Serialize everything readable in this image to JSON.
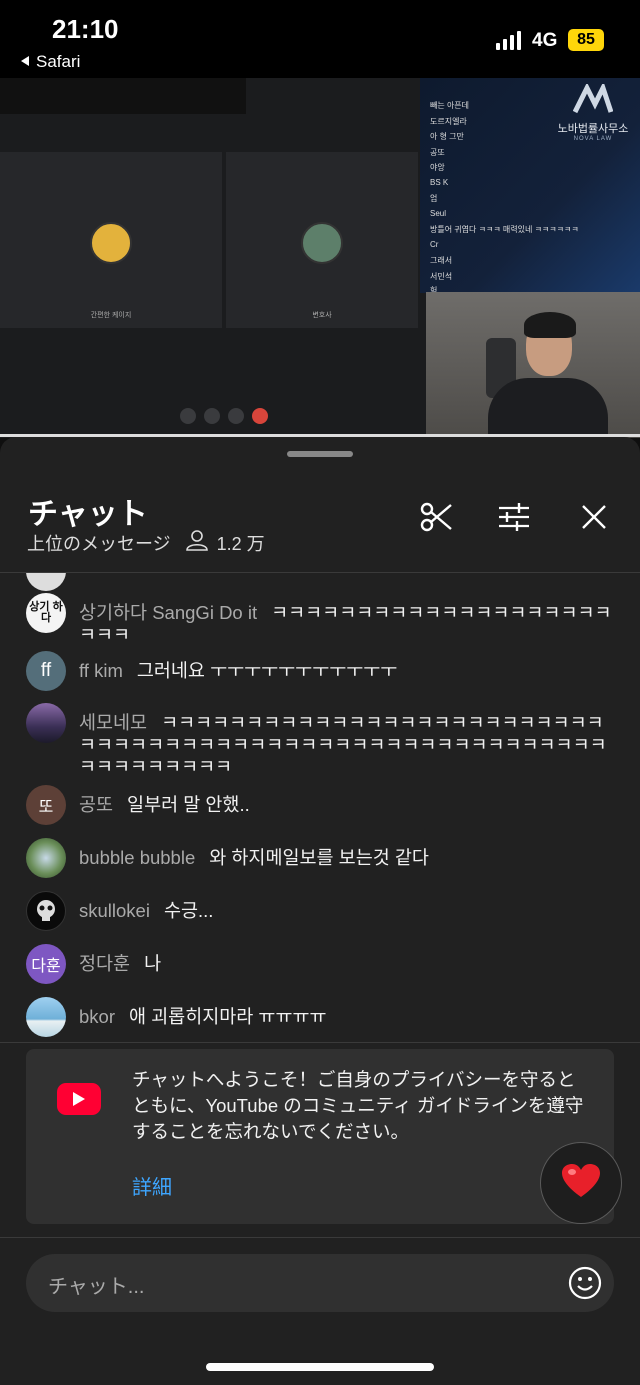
{
  "status_bar": {
    "time": "21:10",
    "back_label": "Safari",
    "network": "4G",
    "battery": "85"
  },
  "video": {
    "participants": [
      "간편한 케이지",
      "변호사"
    ],
    "side_chat_lines": [
      "빼는 아픈데",
      "도르지엘라",
      "아 형 그만",
      "공또",
      "야앙",
      "BS K",
      "엄",
      "Seul",
      "방틀어 귀엽다 ㅋㅋㅋ 매력있네 ㅋㅋㅋㅋㅋㅋ",
      "Cr",
      "그래서",
      "서민석",
      "헉"
    ],
    "logo_korean": "노바법률사무소",
    "logo_english": "NOVA LAW"
  },
  "chat": {
    "title": "チャット",
    "mode": "上位のメッセージ",
    "viewers": "1.2 万",
    "icons": {
      "scissors": "scissors-icon",
      "filter": "filter-icon",
      "close": "close-icon"
    },
    "messages": [
      {
        "author": "상기하다 SangGi Do it",
        "text": "ㅋㅋㅋㅋㅋㅋㅋㅋㅋㅋㅋㅋㅋㅋㅋㅋㅋㅋㅋㅋㅋㅋㅋ",
        "avatar_text": "상기 하다",
        "avatar_color": "#f4f4f4"
      },
      {
        "author": "ff kim",
        "text": "그러네요 ㅜㅜㅜㅜㅜㅜㅜㅜㅜㅜㅜ",
        "avatar_text": "ff",
        "avatar_color": "#546e7a"
      },
      {
        "author": "세모네모",
        "text": "ㅋㅋㅋㅋㅋㅋㅋㅋㅋㅋㅋㅋㅋㅋㅋㅋㅋㅋㅋㅋㅋㅋㅋㅋㅋㅋㅋㅋㅋㅋㅋㅋㅋㅋㅋㅋㅋㅋㅋㅋㅋㅋㅋㅋㅋㅋㅋㅋㅋㅋㅋㅋㅋㅋㅋㅋㅋㅋㅋㅋㅋㅋㅋㅋㅋㅋ",
        "avatar_text": "",
        "avatar_color": "#5a4a70"
      },
      {
        "author": "공또",
        "text": "일부러 말 안했..",
        "avatar_text": "또",
        "avatar_color": "#5d4037"
      },
      {
        "author": "bubble bubble",
        "text": "와 하지메일보를 보는것 같다",
        "avatar_text": "",
        "avatar_color": "#4d6b3a"
      },
      {
        "author": "skullokei",
        "text": "수긍...",
        "avatar_text": "",
        "avatar_color": "#0a0a0a"
      },
      {
        "author": "정다훈",
        "text": "나",
        "avatar_text": "다훈",
        "avatar_color": "#7e57c2"
      },
      {
        "author": "bkor",
        "text": "애 괴롭히지마라 ㅠㅠㅠㅠ",
        "avatar_text": "",
        "avatar_color": "#6fb0d8"
      }
    ],
    "welcome": {
      "text": "チャットへようこそ！ご自身のプライバシーを守るとともに、YouTube のコミュニティ ガイドラインを遵守することを忘れないでください。",
      "more_label": "詳細"
    },
    "input_placeholder": "チャット..."
  }
}
